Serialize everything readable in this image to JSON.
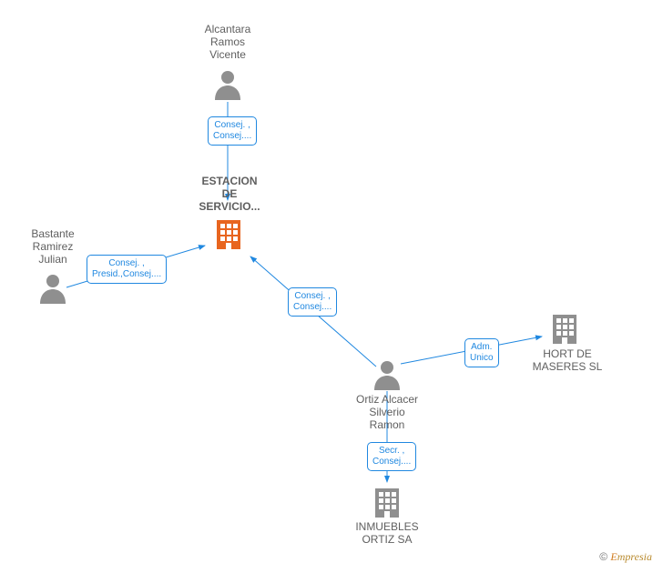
{
  "nodes": {
    "alcantara": {
      "label": "Alcantara\nRamos\nVicente"
    },
    "bastante": {
      "label": "Bastante\nRamirez\nJulian"
    },
    "ortiz": {
      "label": "Ortiz Alcacer\nSilverio\nRamon"
    },
    "estacion": {
      "label": "ESTACION\nDE\nSERVICIO..."
    },
    "hort": {
      "label": "HORT DE\nMASERES SL"
    },
    "inmuebles": {
      "label": "INMUEBLES\nORTIZ SA"
    }
  },
  "edges": {
    "alcantara_estacion": {
      "role": "Consej. ,\nConsej...."
    },
    "bastante_estacion": {
      "role": "Consej. ,\nPresid.,Consej...."
    },
    "ortiz_estacion": {
      "role": "Consej. ,\nConsej...."
    },
    "ortiz_hort": {
      "role": "Adm.\nUnico"
    },
    "ortiz_inmuebles": {
      "role": "Secr. ,\nConsej...."
    }
  },
  "footer": {
    "copyright_symbol": "©",
    "brand": "Empresia",
    "brand_first": "E",
    "brand_rest": "mpresia"
  },
  "colors": {
    "person": "#8f8f8f",
    "company": "#8f8f8f",
    "highlight_company": "#e8651f",
    "edge": "#2088e0",
    "role_border": "#2088e0"
  }
}
